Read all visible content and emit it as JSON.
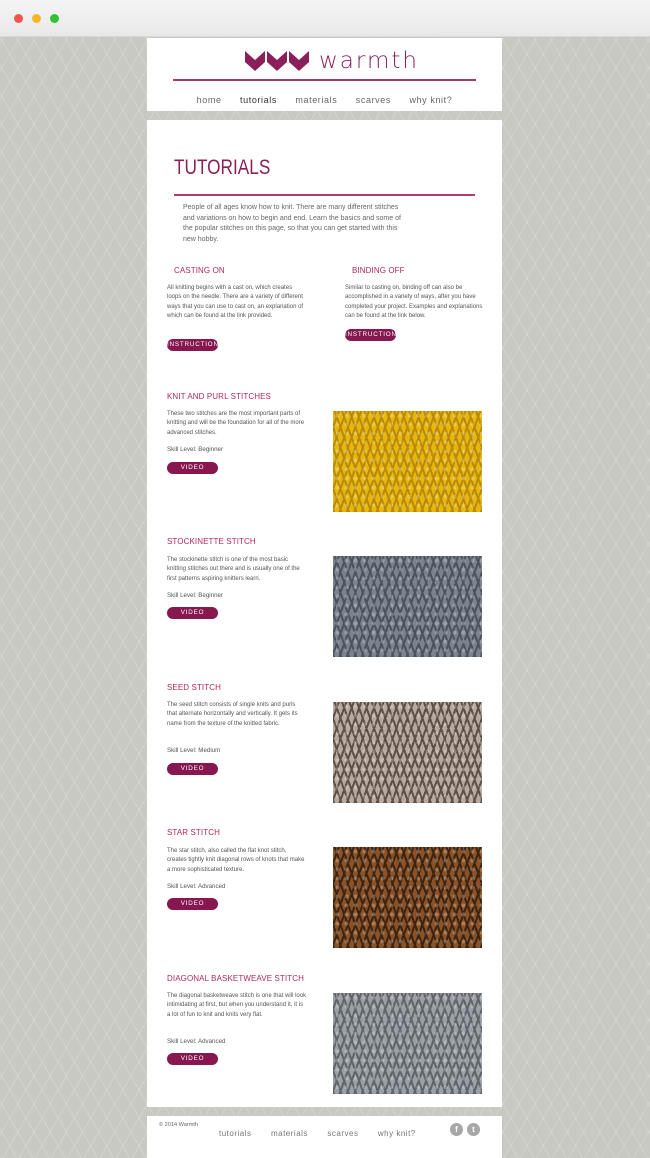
{
  "brand": {
    "name": "warmth",
    "color": "#8b1f5a"
  },
  "nav": [
    {
      "label": "home"
    },
    {
      "label": "tutorials",
      "active": true
    },
    {
      "label": "materials"
    },
    {
      "label": "scarves"
    },
    {
      "label": "why knit?"
    }
  ],
  "page": {
    "title": "TUTORIALS",
    "intro": "People of all ages know how to knit. There are many different stitches and variations on how to begin and end. Learn the basics and some of the popular stitches on this page, so that you can get started with this new hobby."
  },
  "basics": [
    {
      "title": "CASTING ON",
      "text": "All knitting begins with a cast on, which creates loops on the needle. There are a variety of different ways that you can use to cast on, an explanation of which can be found at the link provided.",
      "button": "INSTRUCTIONS"
    },
    {
      "title": "BINDING OFF",
      "text": "Similar to casting on, binding off can also be accomplished in a variety of ways, after you have completed your project. Examples and explanations can be found at the link below.",
      "button": "INSTRUCTIONS"
    }
  ],
  "stitches": [
    {
      "title": "KNIT AND PURL STITCHES",
      "text": "These two stitches are the most important parts of knitting and will be the foundation for all of the more advanced stitches.",
      "skill": "Skill Level: Beginner",
      "button": "VIDEO",
      "swatch_color": "#e8b60f",
      "swatch_dark": "#b88a05"
    },
    {
      "title": "STOCKINETTE STITCH",
      "text": "The stockinette stitch is one of the most basic knitting stitches out there and is usually one of the first patterns aspiring knitters learn.",
      "skill": "Skill Level: Beginner",
      "button": "VIDEO",
      "swatch_color": "#7a8390",
      "swatch_dark": "#4c535d"
    },
    {
      "title": "SEED STITCH",
      "text": "The seed stitch consists of single knits and purls that alternate horizontally and vertically. It gets its name from the texture of the knitted fabric.",
      "skill": "Skill Level: Medium",
      "button": "VIDEO",
      "swatch_color": "#b8a89d",
      "swatch_dark": "#5e5049"
    },
    {
      "title": "STAR STITCH",
      "text": "The star stitch, also called the flat knot stitch, creates tightly knit diagonal rows of knots that make a more sophisticated texture.",
      "skill": "Skill Level: Advanced",
      "button": "VIDEO",
      "swatch_color": "#8a5226",
      "swatch_dark": "#3e2410"
    },
    {
      "title": "DIAGONAL BASKETWEAVE STITCH",
      "text": "The diagonal basketweave stitch is one that will look intimidating at first, but when you understand it, it is a lot of fun to knit and knits very flat.",
      "skill": "Skill Level: Advanced",
      "button": "VIDEO",
      "swatch_color": "#9aa0a6",
      "swatch_dark": "#5f656b"
    }
  ],
  "footer": {
    "copyright": "© 2014 Warmth",
    "nav": [
      {
        "label": "tutorials"
      },
      {
        "label": "materials"
      },
      {
        "label": "scarves"
      },
      {
        "label": "why knit?"
      }
    ],
    "social": [
      {
        "icon": "facebook-icon",
        "glyph": "f"
      },
      {
        "icon": "twitter-icon",
        "glyph": "t"
      }
    ]
  }
}
